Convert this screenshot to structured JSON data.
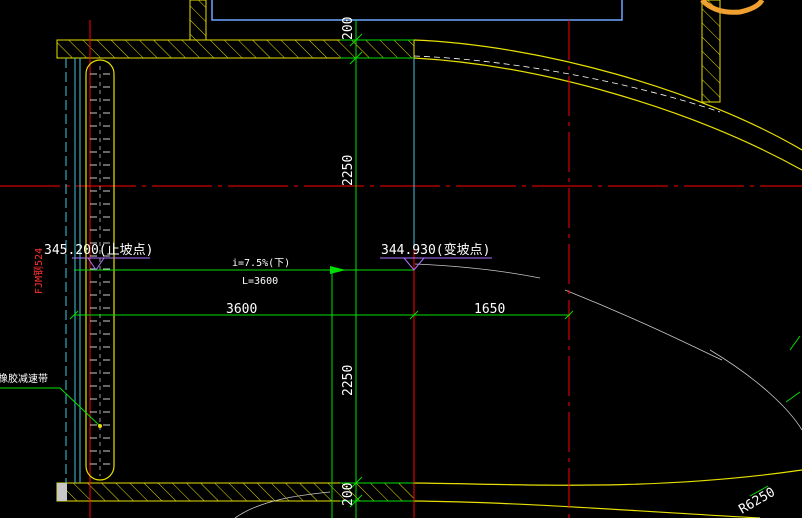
{
  "colors": {
    "background": "#000000",
    "wall": "#e8e000",
    "dimension": "#00e000",
    "axis": "#ff0000",
    "cyan": "#40c8e0",
    "text": "#ffffff",
    "label_red": "#ff3030",
    "grey": "#c8c8c8",
    "accent_orange": "#f0a030"
  },
  "dimensions": {
    "top_200": "200",
    "upper_2250": "2250",
    "lower_2250": "2250",
    "bottom_200": "200",
    "horizontal_3600": "3600",
    "horizontal_1650": "1650",
    "radius_partial": "R6250"
  },
  "elevations": {
    "start": "345.200(止坡点)",
    "change": "344.930(变坡点)"
  },
  "slope": {
    "grade": "i=7.5%(下)",
    "length": "L=3600"
  },
  "labels": {
    "door_code": "FJM钢524",
    "speed_bump": "橡胶减速带"
  }
}
